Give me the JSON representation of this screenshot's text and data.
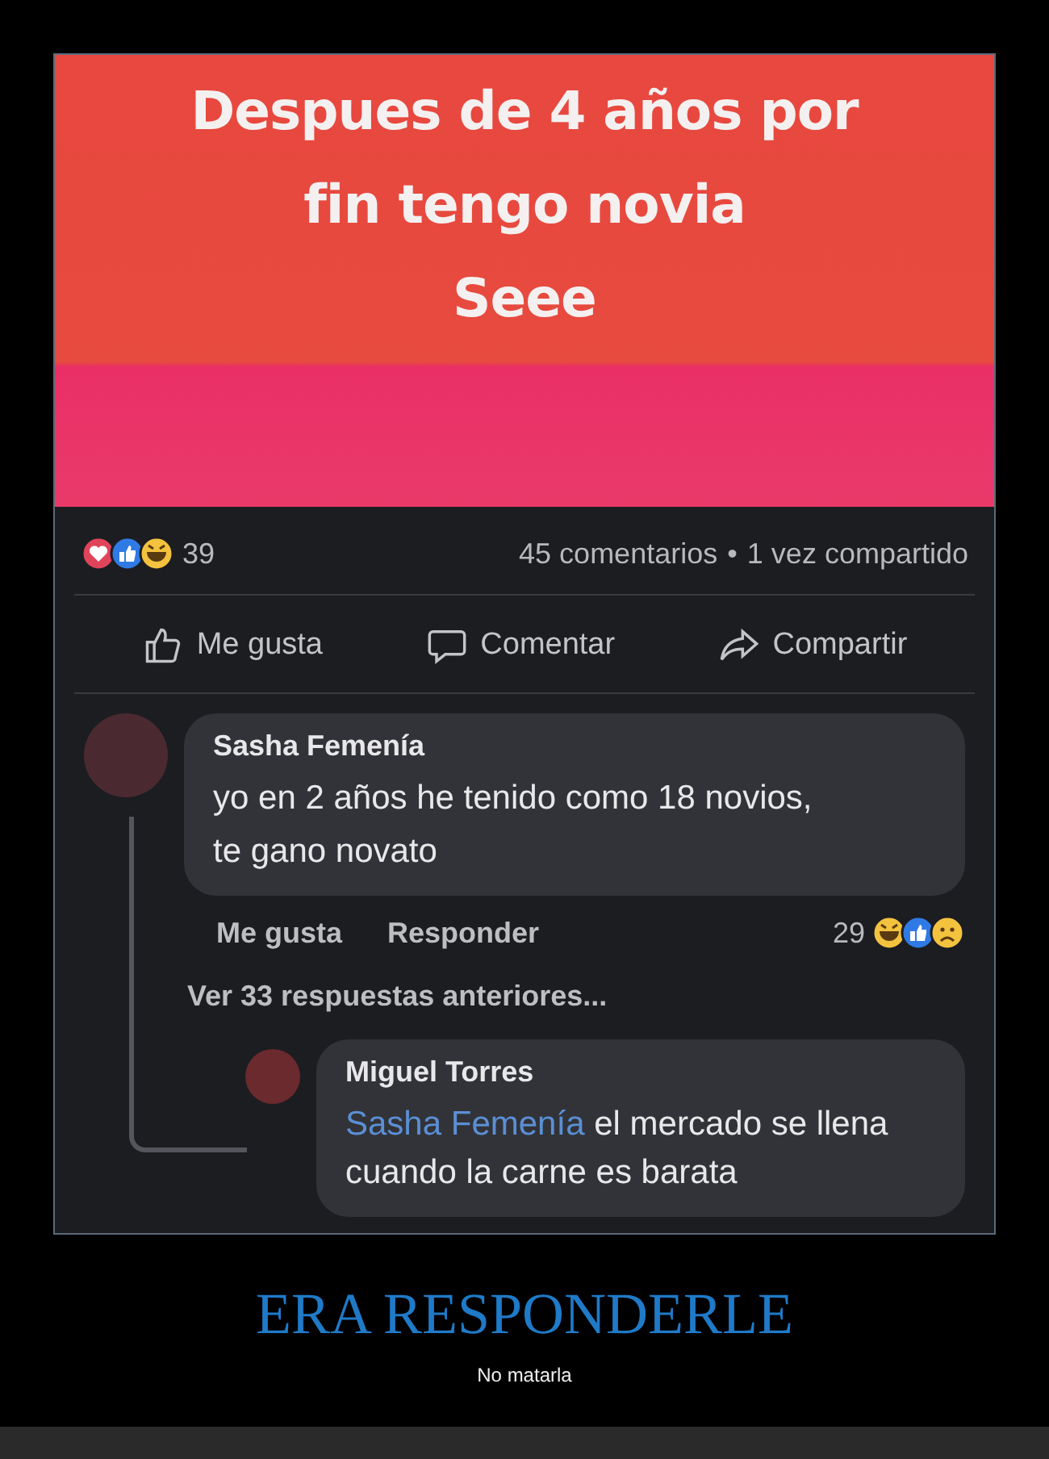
{
  "banner": {
    "lines": [
      "Despues de 4 años por",
      "fin tengo novia",
      "Seee"
    ]
  },
  "post_stats": {
    "reactions": [
      {
        "kind": "love"
      },
      {
        "kind": "like"
      },
      {
        "kind": "haha"
      }
    ],
    "reaction_count": "39",
    "comments": "45 comentarios",
    "separator": "•",
    "shares": "1 vez compartido"
  },
  "actions": [
    {
      "kind": "like",
      "label": "Me gusta"
    },
    {
      "kind": "comment",
      "label": "Comentar"
    },
    {
      "kind": "share",
      "label": "Compartir"
    }
  ],
  "comment": {
    "author": "Sasha Femenía",
    "lines": [
      "yo en 2 años he tenido como 18 novios,",
      "te gano novato"
    ],
    "like": "Me gusta",
    "reply": "Responder",
    "reaction_count": "29",
    "reactions": [
      {
        "kind": "haha"
      },
      {
        "kind": "like"
      },
      {
        "kind": "sad"
      }
    ]
  },
  "more_replies": "Ver 33 respuestas anteriores...",
  "reply": {
    "author": "Miguel Torres",
    "mention": "Sasha Femenía",
    "text": "el mercado se llena",
    "line2": "cuando la carne es barata"
  },
  "caption": {
    "title": "ERA RESPONDERLE",
    "subtitle": "No matarla"
  }
}
